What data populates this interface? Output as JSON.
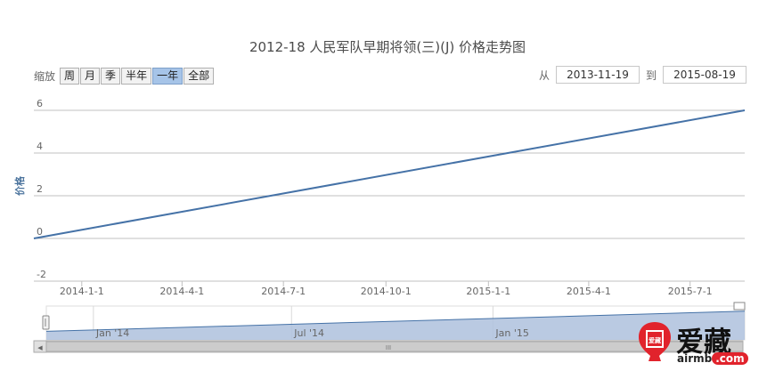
{
  "title": "2012-18 人民军队早期将领(三)(J) 价格走势图",
  "zoom": {
    "label": "缩放",
    "buttons": [
      "周",
      "月",
      "季",
      "半年",
      "一年",
      "全部"
    ],
    "selected": "一年"
  },
  "range": {
    "from_label": "从",
    "from_value": "2013-11-19",
    "to_label": "到",
    "to_value": "2015-08-19"
  },
  "chart_data": {
    "type": "line",
    "title": "2012-18 人民军队早期将领(三)(J) 价格走势图",
    "ylabel": "价格",
    "xlabel": "",
    "ylim": [
      -2,
      7
    ],
    "xlim": [
      "2013-11-19",
      "2015-08-19"
    ],
    "y_ticks": [
      -2,
      0,
      2,
      4,
      6
    ],
    "x_ticks": [
      {
        "date": "2014-01-01",
        "label": "2014-1-1"
      },
      {
        "date": "2014-04-01",
        "label": "2014-4-1"
      },
      {
        "date": "2014-07-01",
        "label": "2014-7-1"
      },
      {
        "date": "2014-10-01",
        "label": "2014-10-1"
      },
      {
        "date": "2015-01-01",
        "label": "2015-1-1"
      },
      {
        "date": "2015-04-01",
        "label": "2015-4-1"
      },
      {
        "date": "2015-07-01",
        "label": "2015-7-1"
      }
    ],
    "grid": true,
    "series": [
      {
        "points": [
          {
            "x": "2013-11-19",
            "y": 0.0
          },
          {
            "x": "2015-08-19",
            "y": 6.0
          }
        ]
      }
    ],
    "navigator": {
      "labels": [
        {
          "date": "2014-01-01",
          "label": "Jan '14"
        },
        {
          "date": "2014-07-01",
          "label": "Jul '14"
        },
        {
          "date": "2015-01-01",
          "label": "Jan '15"
        }
      ]
    }
  },
  "colors": {
    "line": "#4572a7",
    "navigator_fill": "#b2c4df",
    "grid": "#c0c0c0",
    "axis_text": "#666666",
    "ylabel": "#4d759e"
  },
  "scrollbar": {
    "left_arrow": "◀",
    "right_arrow": "▶",
    "grip": "III"
  },
  "logo": {
    "name": "爱藏",
    "site_prefix": "airmb",
    "site_suffix": ".com",
    "seal_text": "爱藏"
  }
}
